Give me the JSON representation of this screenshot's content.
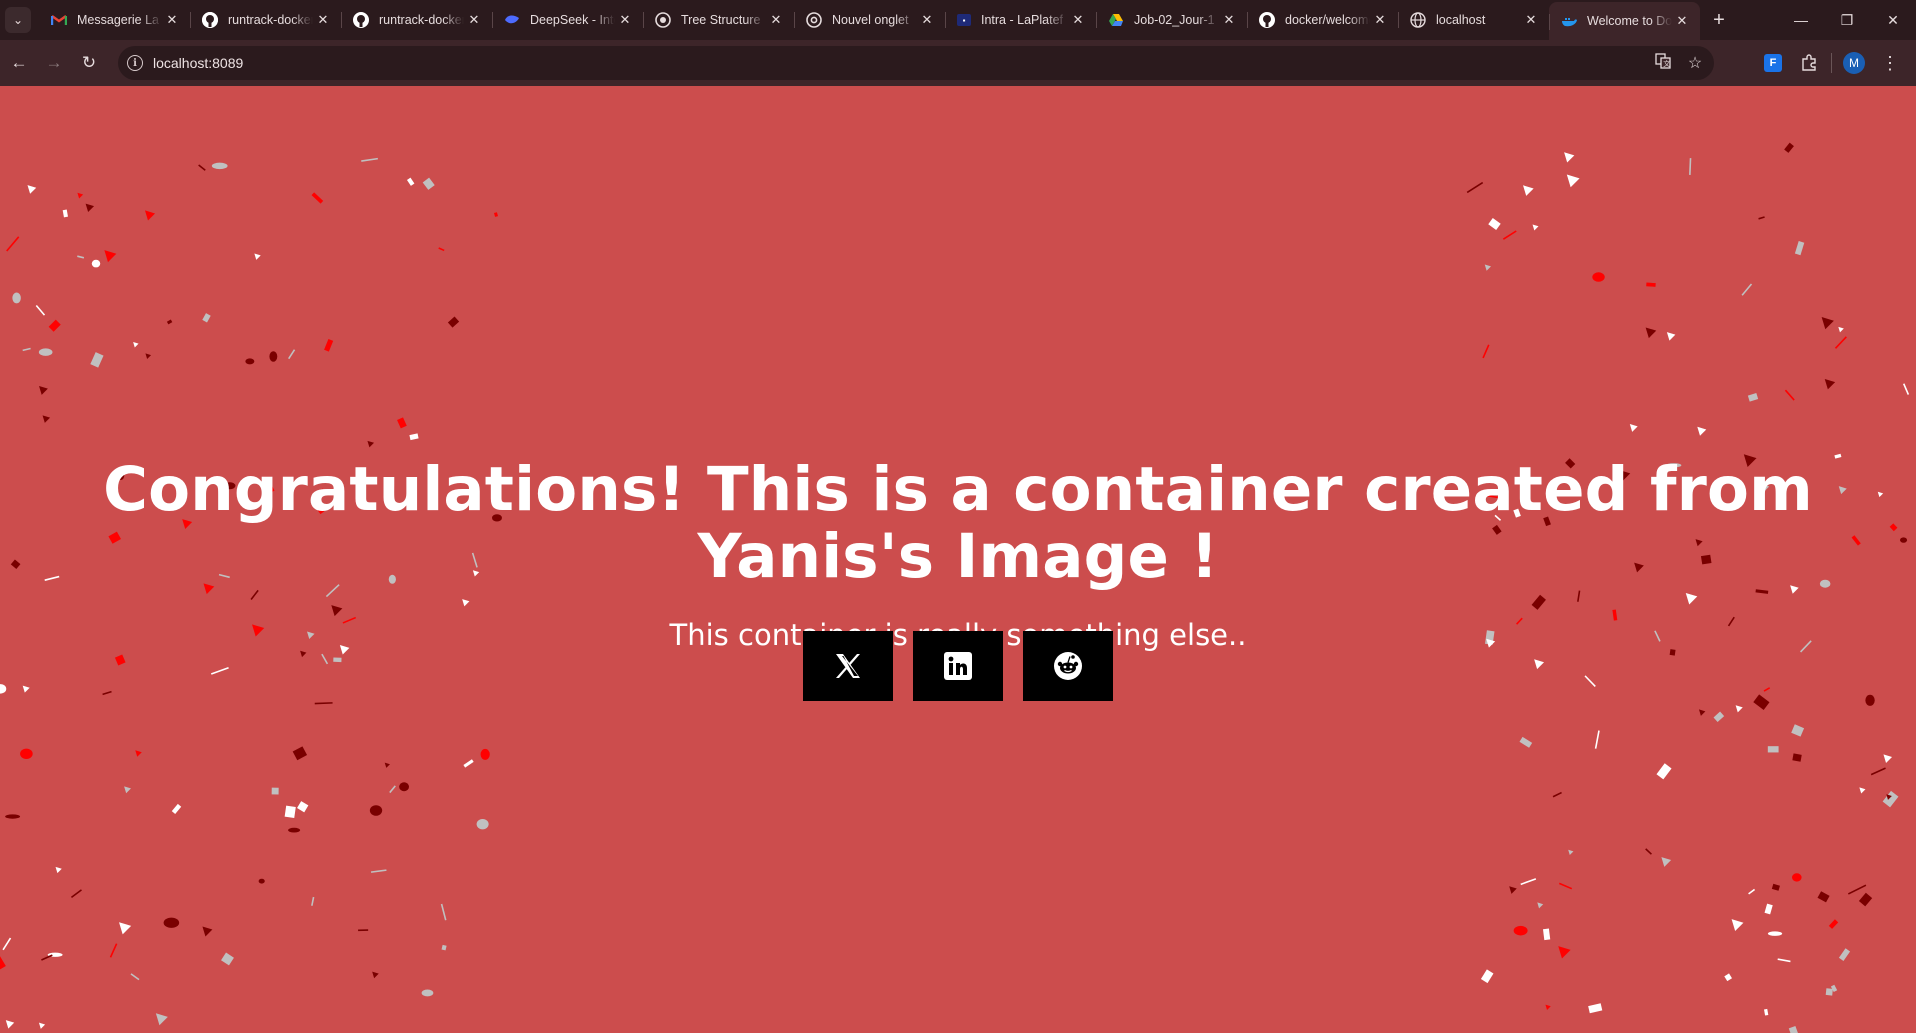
{
  "browser": {
    "tab_menu_icon": "chevron-down-icon",
    "tabs": [
      {
        "title": "Messagerie La",
        "favicon": "gmail-icon",
        "active": false
      },
      {
        "title": "runtrack-docker",
        "favicon": "github-icon",
        "active": false
      },
      {
        "title": "runtrack-docker",
        "favicon": "github-icon",
        "active": false
      },
      {
        "title": "DeepSeek - Into",
        "favicon": "deepseek-icon",
        "active": false
      },
      {
        "title": "Tree Structure",
        "favicon": "tree-structure-icon",
        "active": false
      },
      {
        "title": "Nouvel onglet",
        "favicon": "chrome-icon",
        "active": false
      },
      {
        "title": "Intra - LaPlatef",
        "favicon": "intra-icon",
        "active": false
      },
      {
        "title": "Job-02_Jour-1",
        "favicon": "google-drive-icon",
        "active": false
      },
      {
        "title": "docker/welcome",
        "favicon": "github-icon",
        "active": false
      },
      {
        "title": "localhost",
        "favicon": "globe-icon",
        "active": false
      },
      {
        "title": "Welcome to Do",
        "favicon": "docker-icon",
        "active": true
      }
    ],
    "url": "localhost:8089",
    "profile_initial": "M",
    "extension_label": "F"
  },
  "page": {
    "background_color": "#cc4d4d",
    "title": "Congratulations! This is a container created from Yanis's Image !",
    "subtitle": "This container is really something else..",
    "social_buttons": [
      {
        "name": "x-twitter",
        "icon": "x-icon"
      },
      {
        "name": "linkedin",
        "icon": "linkedin-icon"
      },
      {
        "name": "reddit",
        "icon": "reddit-icon"
      }
    ],
    "confetti_colors": [
      "#ffffff",
      "#ff0000",
      "#7a0000",
      "#c0c0c0"
    ]
  }
}
